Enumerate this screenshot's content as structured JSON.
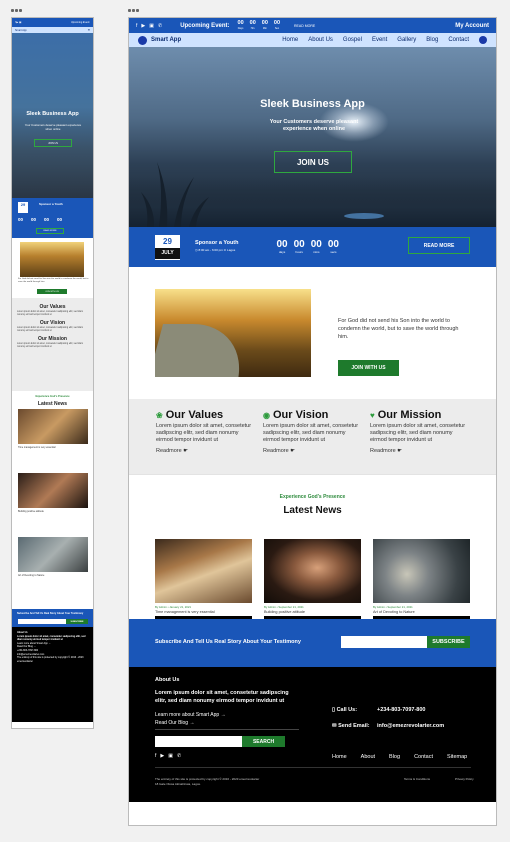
{
  "topbar": {
    "social": [
      "f",
      "▶",
      "▣",
      "✆"
    ],
    "upcoming_label": "Upcoming Event:",
    "countdown": [
      {
        "v": "00",
        "u": "Days"
      },
      {
        "v": "00",
        "u": "Hrs"
      },
      {
        "v": "00",
        "u": "Min"
      },
      {
        "v": "00",
        "u": "Sec"
      }
    ],
    "read_more": "READ MORE",
    "account": "My Account"
  },
  "nav": {
    "brand": "Smart App",
    "items": [
      "Home",
      "About Us",
      "Gospel",
      "Event",
      "Gallery",
      "Blog",
      "Contact"
    ]
  },
  "hero": {
    "title": "Sleek Business App",
    "subtitle": "Your Customers deserve pleasant experience when online",
    "cta": "JOIN US"
  },
  "event": {
    "day": "29",
    "month": "JULY",
    "name": "Sponsor a Youth",
    "time": "8:00 am - 6:00 pm",
    "place": "Lagos",
    "countdown": [
      {
        "v": "00",
        "u": "days"
      },
      {
        "v": "00",
        "u": "hours"
      },
      {
        "v": "00",
        "u": "mins"
      },
      {
        "v": "00",
        "u": "secs"
      }
    ],
    "cta": "READ MORE"
  },
  "about": {
    "text": "For God did not send his Son into the world to condemn the world, but to save the world through him.",
    "cta": "JOIN WITH US"
  },
  "values": [
    {
      "icon": "fire-icon",
      "glyph": "❀",
      "title": "Our Values",
      "text": "Lorem ipsum dolor sit amet, consetetur sadipscing elitr, sed diam nonumy eirmod tempor invidunt ut",
      "link": "Readmore ☛"
    },
    {
      "icon": "eye-icon",
      "glyph": "◉",
      "title": "Our Vision",
      "text": "Lorem ipsum dolor sit amet, consetetur sadipscing elitr, sed diam nonumy eirmod tempor invidunt ut",
      "link": "Readmore ☛"
    },
    {
      "icon": "heart-icon",
      "glyph": "♥",
      "title": "Our Mission",
      "text": "Lorem ipsum dolor sit amet, consetetur sadipscing elitr, sed diam nonumy eirmod tempor invidunt ut",
      "link": "Readmore ☛"
    }
  ],
  "news": {
    "kicker": "Experience God's Presence",
    "title": "Latest News",
    "cards": [
      {
        "meta": "By Admin • January 21, 2021",
        "title": "Time management is very essential",
        "author": "By Admin",
        "more": "Read More"
      },
      {
        "meta": "By Admin • September 21, 2021",
        "title": "Building positive attitude",
        "author": "By Admin",
        "more": "Read More"
      },
      {
        "meta": "By Admin • September 21, 2021",
        "title": "Art of Devoting to Nature",
        "author": "By Admin",
        "more": "Read More"
      }
    ]
  },
  "subscribe": {
    "text": "Subscribe And Tell Us Real Story About Your Testimony",
    "placeholder": "",
    "cta": "SUBSCRIBE"
  },
  "footer": {
    "heading": "About Us",
    "lead": "Lorem ipsum dolor sit amet, consetetur sadipscing elitr, sed diam nonumy eirmod tempor invidunt ut",
    "learn_more": "Learn more about Smart App →",
    "read_blog": "Read Our Blog →",
    "search_cta": "SEARCH",
    "call_label": "Call Us:",
    "call_value": "+234-803-7097-800",
    "email_label": "Send Email:",
    "email_value": "info@emezrevolarter.com",
    "links": [
      "Home",
      "About",
      "Blog",
      "Contact",
      "Sitemap"
    ],
    "copyright": "The entirety of this site is protected by copyright © 2016 - 2023 emezrevolarter",
    "address": "18 Isale Olosa Akinahinwa, Lagos.",
    "legal": [
      "Terms & Conditions",
      "Privacy Policy"
    ]
  },
  "mobile": {
    "top_title": "Upcoming Event:",
    "brand": "Smart App",
    "hero_title": "Sleek Business App",
    "hero_sub": "Your Customers deserve pleasant experience when online",
    "hero_cta": "JOIN US",
    "event_day": "29",
    "event_name": "Sponsor a Youth",
    "event_cta": "READ MORE",
    "about_cta": "JOIN WITH US",
    "values": [
      "Our Values",
      "Our Vision",
      "Our Mission"
    ],
    "news_kicker": "Experience God's Presence",
    "news_title": "Latest News",
    "news": [
      "Time management is very essential",
      "Building positive attitude",
      "Art of Devoting to Nature"
    ],
    "sub_text": "Subscribe And Tell Us Real Story About Your Testimony",
    "sub_cta": "SUBSCRIBE",
    "foot_head": "About Us"
  }
}
